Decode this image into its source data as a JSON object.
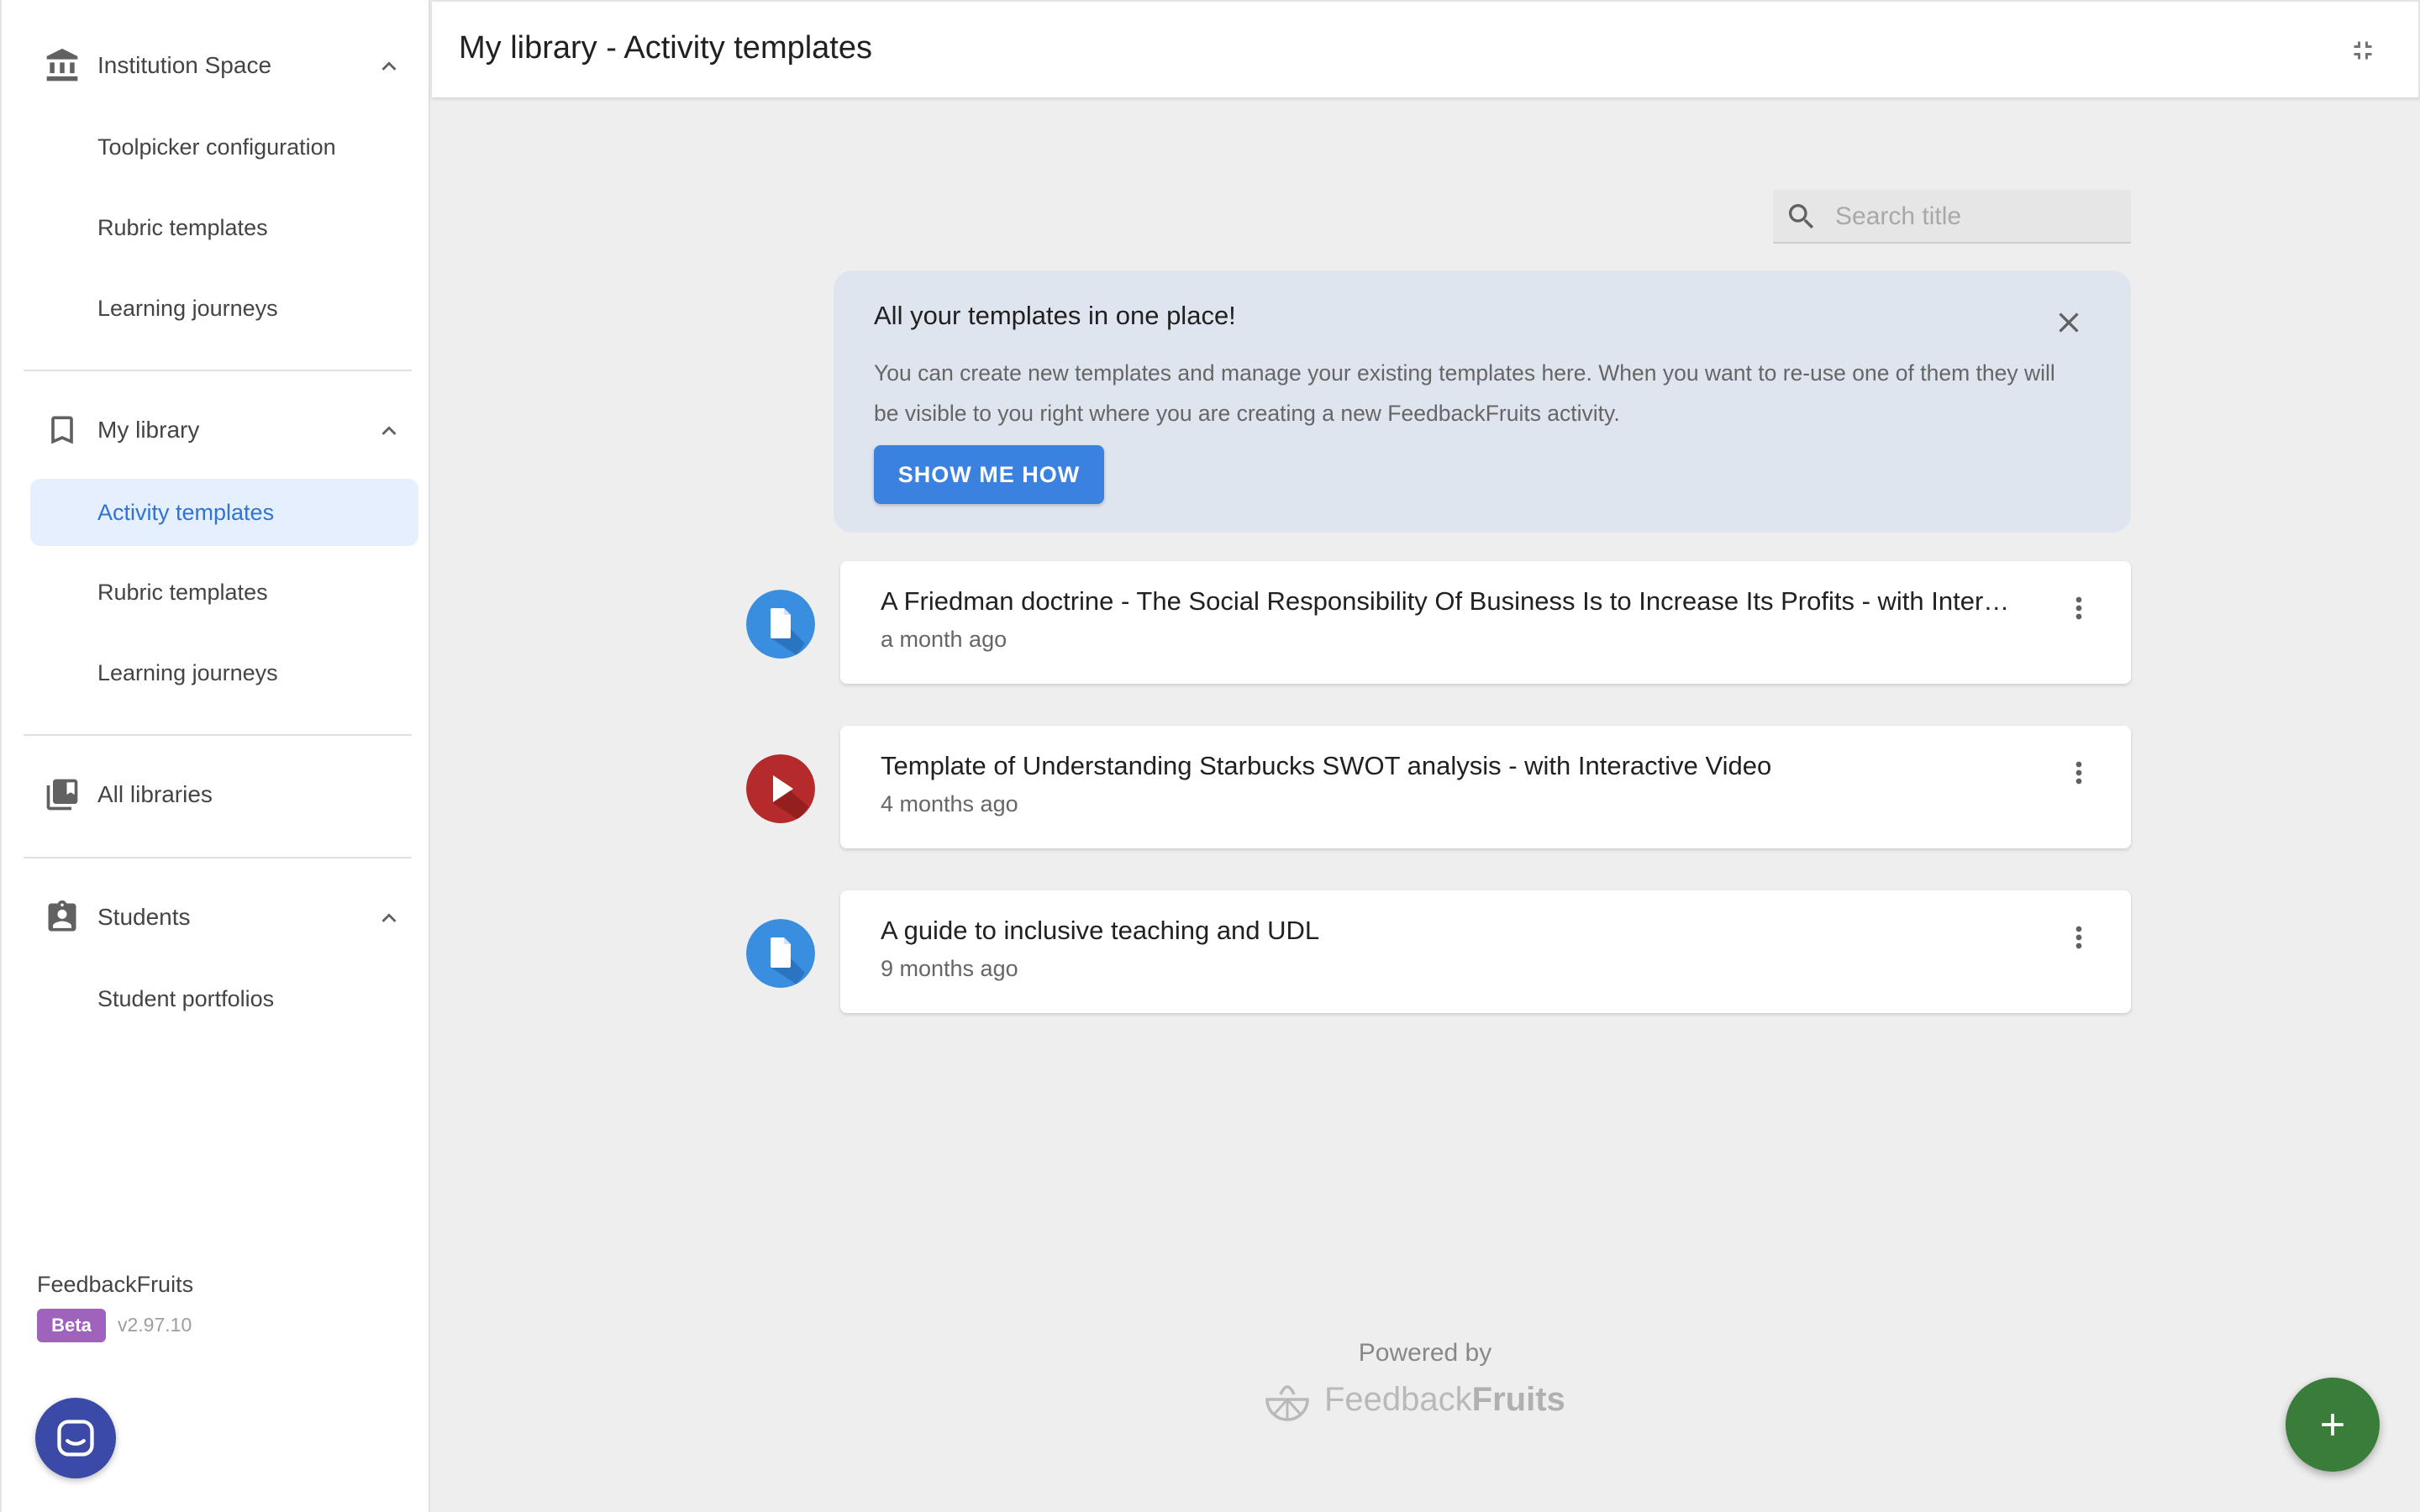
{
  "sidebar": {
    "sections": [
      {
        "label": "Institution Space",
        "icon": "institution-icon",
        "items": [
          "Toolpicker configuration",
          "Rubric templates",
          "Learning journeys"
        ]
      },
      {
        "label": "My library",
        "icon": "bookmark-icon",
        "items": [
          "Activity templates",
          "Rubric templates",
          "Learning journeys"
        ],
        "active_item": "Activity templates"
      },
      {
        "label": "All libraries",
        "icon": "libraries-icon",
        "items": []
      },
      {
        "label": "Students",
        "icon": "student-badge-icon",
        "items": [
          "Student portfolios"
        ]
      }
    ],
    "brand": "FeedbackFruits",
    "badge": "Beta",
    "version": "v2.97.10"
  },
  "header": {
    "title": "My library - Activity templates"
  },
  "search": {
    "placeholder": "Search title",
    "value": ""
  },
  "banner": {
    "title": "All your templates in one place!",
    "text": "You can create new templates and manage your existing templates here. When you want to re-use one of them they will be visible to you right where you are creating a new FeedbackFruits activity.",
    "button": "SHOW ME HOW"
  },
  "templates": [
    {
      "title": "A Friedman doctrine - The Social Responsibility Of Business Is to Increase Its Profits - with Interactive Document",
      "date": "a month ago",
      "type": "document",
      "color": "#3a8ee0"
    },
    {
      "title": "Template of Understanding Starbucks SWOT analysis - with Interactive Video",
      "date": "4 months ago",
      "type": "video",
      "color": "#b52a2a"
    },
    {
      "title": "A guide to inclusive teaching and UDL",
      "date": "9 months ago",
      "type": "document",
      "color": "#3a8ee0"
    }
  ],
  "footer": {
    "powered_by": "Powered by",
    "logo_light": "Feedback",
    "logo_bold": "Fruits"
  },
  "colors": {
    "accent": "#3b82e0",
    "active_bg": "#e6effd",
    "fab": "#3a7d3a",
    "chat": "#3b4aa6",
    "beta": "#a063bd"
  }
}
